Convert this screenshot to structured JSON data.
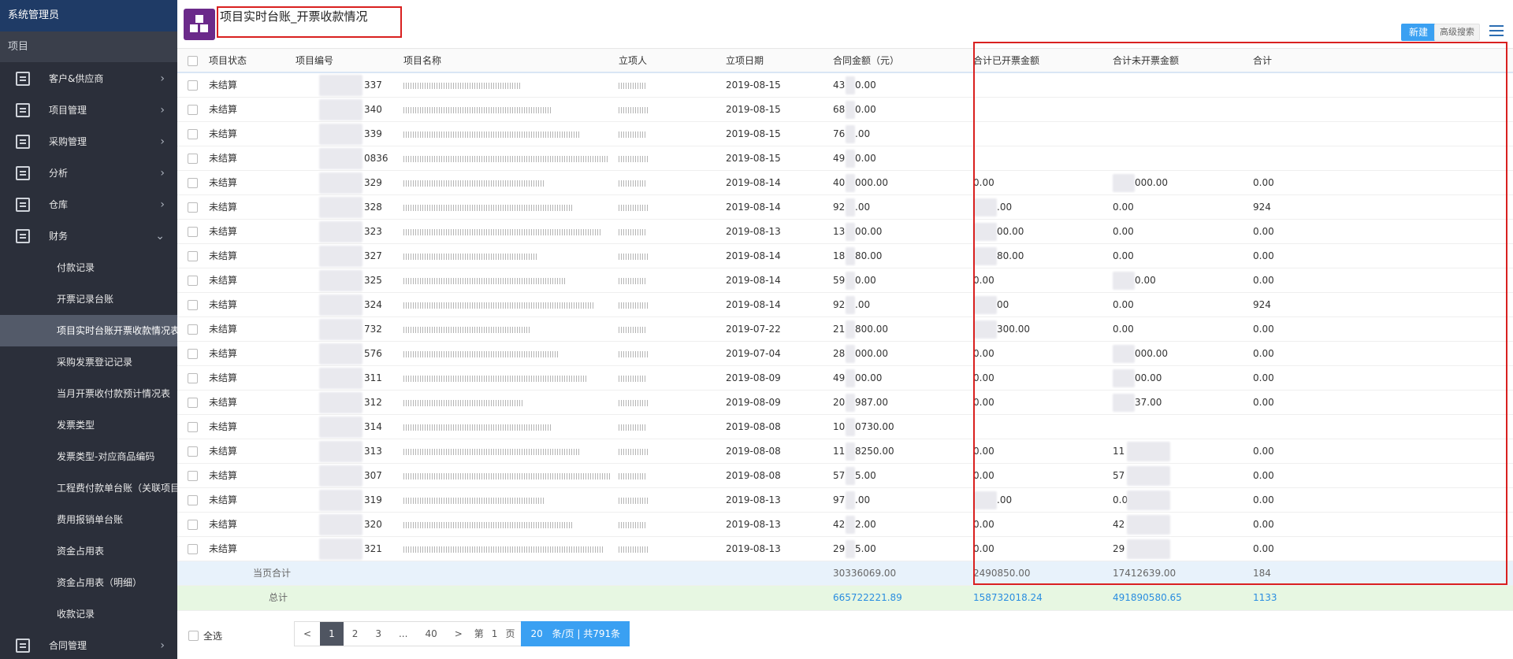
{
  "sidebar": {
    "user": "系统管理员",
    "search_label": "项目",
    "menu": [
      {
        "label": "客户&供应商"
      },
      {
        "label": "项目管理"
      },
      {
        "label": "采购管理"
      },
      {
        "label": "分析"
      },
      {
        "label": "仓库"
      },
      {
        "label": "财务"
      }
    ],
    "finance_sub": [
      {
        "label": "付款记录"
      },
      {
        "label": "开票记录台账"
      },
      {
        "label": "项目实时台账开票收款情况表"
      },
      {
        "label": "采购发票登记记录"
      },
      {
        "label": "当月开票收付款预计情况表"
      },
      {
        "label": "发票类型"
      },
      {
        "label": "发票类型-对应商品编码"
      },
      {
        "label": "工程费付款单台账（关联项目"
      },
      {
        "label": "费用报销单台账"
      },
      {
        "label": "资金占用表"
      },
      {
        "label": "资金占用表（明细）"
      },
      {
        "label": "收款记录"
      }
    ],
    "menu_bottom": {
      "label": "合同管理"
    },
    "chevron_right": "›",
    "chevron_down": "⌄"
  },
  "header": {
    "title": "项目实时台账_开票收款情况",
    "new_button": "新建",
    "advanced_search": "高级搜索"
  },
  "table": {
    "columns": [
      "项目状态",
      "项目编号",
      "项目名称",
      "立项人",
      "立项日期",
      "合同金额（元）",
      "合计已开票金额",
      "合计未开票金额",
      "合计"
    ],
    "rows": [
      {
        "status": "未结算",
        "code": "337",
        "date": "2019-08-15",
        "contract": "43",
        "contract_tail": "0.00",
        "invoiced": "",
        "invoiced_tail": "",
        "uninvoiced": "",
        "uninvoiced_tail": "",
        "extra": ""
      },
      {
        "status": "未结算",
        "code": "340",
        "date": "2019-08-15",
        "contract": "68",
        "contract_tail": "0.00",
        "invoiced": "",
        "invoiced_tail": "",
        "uninvoiced": "",
        "uninvoiced_tail": "",
        "extra": ""
      },
      {
        "status": "未结算",
        "code": "339",
        "date": "2019-08-15",
        "contract": "76",
        "contract_tail": ".00",
        "invoiced": "",
        "invoiced_tail": "",
        "uninvoiced": "",
        "uninvoiced_tail": "",
        "extra": ""
      },
      {
        "status": "未结算",
        "code": "0836",
        "date": "2019-08-15",
        "contract": "49",
        "contract_tail": "0.00",
        "invoiced": "",
        "invoiced_tail": "",
        "uninvoiced": "",
        "uninvoiced_tail": "",
        "extra": ""
      },
      {
        "status": "未结算",
        "code": "329",
        "date": "2019-08-14",
        "contract": "40",
        "contract_tail": "000.00",
        "invoiced": "0.00",
        "invoiced_tail": "",
        "uninvoiced": "",
        "uninvoiced_tail": "000.00",
        "extra": "0.00"
      },
      {
        "status": "未结算",
        "code": "328",
        "date": "2019-08-14",
        "contract": "92",
        "contract_tail": ".00",
        "invoiced": "",
        "invoiced_tail": ".00",
        "uninvoiced": "0.00",
        "uninvoiced_tail": "",
        "extra": "924"
      },
      {
        "status": "未结算",
        "code": "323",
        "date": "2019-08-13",
        "contract": "13",
        "contract_tail": "00.00",
        "invoiced": "",
        "invoiced_tail": "00.00",
        "uninvoiced": "0.00",
        "uninvoiced_tail": "",
        "extra": "0.00"
      },
      {
        "status": "未结算",
        "code": "327",
        "date": "2019-08-14",
        "contract": "18",
        "contract_tail": "80.00",
        "invoiced": "",
        "invoiced_tail": "80.00",
        "uninvoiced": "0.00",
        "uninvoiced_tail": "",
        "extra": "0.00"
      },
      {
        "status": "未结算",
        "code": "325",
        "date": "2019-08-14",
        "contract": "59",
        "contract_tail": "0.00",
        "invoiced": "0.00",
        "invoiced_tail": "",
        "uninvoiced": "",
        "uninvoiced_tail": "0.00",
        "extra": "0.00"
      },
      {
        "status": "未结算",
        "code": "324",
        "date": "2019-08-14",
        "contract": "92",
        "contract_tail": ".00",
        "invoiced": "",
        "invoiced_tail": "00",
        "uninvoiced": "0.00",
        "uninvoiced_tail": "",
        "extra": "924"
      },
      {
        "status": "未结算",
        "code": "732",
        "date": "2019-07-22",
        "contract": "21",
        "contract_tail": "800.00",
        "invoiced": "",
        "invoiced_tail": "300.00",
        "uninvoiced": "0.00",
        "uninvoiced_tail": "",
        "extra": "0.00"
      },
      {
        "status": "未结算",
        "code": "576",
        "date": "2019-07-04",
        "contract": "28",
        "contract_tail": "000.00",
        "invoiced": "0.00",
        "invoiced_tail": "",
        "uninvoiced": "",
        "uninvoiced_tail": "000.00",
        "extra": "0.00"
      },
      {
        "status": "未结算",
        "code": "311",
        "date": "2019-08-09",
        "contract": "49",
        "contract_tail": "00.00",
        "invoiced": "0.00",
        "invoiced_tail": "",
        "uninvoiced": "",
        "uninvoiced_tail": "00.00",
        "extra": "0.00"
      },
      {
        "status": "未结算",
        "code": "312",
        "date": "2019-08-09",
        "contract": "20",
        "contract_tail": "987.00",
        "invoiced": "0.00",
        "invoiced_tail": "",
        "uninvoiced": "",
        "uninvoiced_tail": "37.00",
        "extra": "0.00"
      },
      {
        "status": "未结算",
        "code": "314",
        "date": "2019-08-08",
        "contract": "10",
        "contract_tail": "0730.00",
        "invoiced": "",
        "invoiced_tail": "",
        "uninvoiced": "",
        "uninvoiced_tail": "",
        "extra": ""
      },
      {
        "status": "未结算",
        "code": "313",
        "date": "2019-08-08",
        "contract": "11",
        "contract_tail": "8250.00",
        "invoiced": "0.00",
        "invoiced_tail": "",
        "uninvoiced": "11",
        "uninvoiced_tail": "",
        "extra": "0.00"
      },
      {
        "status": "未结算",
        "code": "307",
        "date": "2019-08-08",
        "contract": "57",
        "contract_tail": "5.00",
        "invoiced": "0.00",
        "invoiced_tail": "",
        "uninvoiced": "57",
        "uninvoiced_tail": "",
        "extra": "0.00"
      },
      {
        "status": "未结算",
        "code": "319",
        "date": "2019-08-13",
        "contract": "97",
        "contract_tail": ".00",
        "invoiced": "",
        "invoiced_tail": ".00",
        "uninvoiced": "0.0",
        "uninvoiced_tail": "",
        "extra": "0.00"
      },
      {
        "status": "未结算",
        "code": "320",
        "date": "2019-08-13",
        "contract": "42",
        "contract_tail": "2.00",
        "invoiced": "0.00",
        "invoiced_tail": "",
        "uninvoiced": "42",
        "uninvoiced_tail": "",
        "extra": "0.00"
      },
      {
        "status": "未结算",
        "code": "321",
        "date": "2019-08-13",
        "contract": "29",
        "contract_tail": "5.00",
        "invoiced": "0.00",
        "invoiced_tail": "",
        "uninvoiced": "29",
        "uninvoiced_tail": "",
        "extra": "0.00"
      }
    ],
    "page_sum": {
      "label": "当页合计",
      "contract": "30336069.00",
      "invoiced": "2490850.00",
      "uninvoiced": "17412639.00",
      "extra": "184"
    },
    "grand_total": {
      "label": "总计",
      "contract": "665722221.89",
      "invoiced": "158732018.24",
      "uninvoiced": "491890580.65",
      "extra": "1133"
    }
  },
  "footer": {
    "select_all": "全选",
    "pager": {
      "prev": "<",
      "pages": [
        "1",
        "2",
        "3",
        "...",
        "40"
      ],
      "next": ">",
      "goto_prefix": "第",
      "goto_value": "1",
      "goto_suffix": "页",
      "page_size": "20",
      "summary": "条/页 | 共791条"
    }
  }
}
